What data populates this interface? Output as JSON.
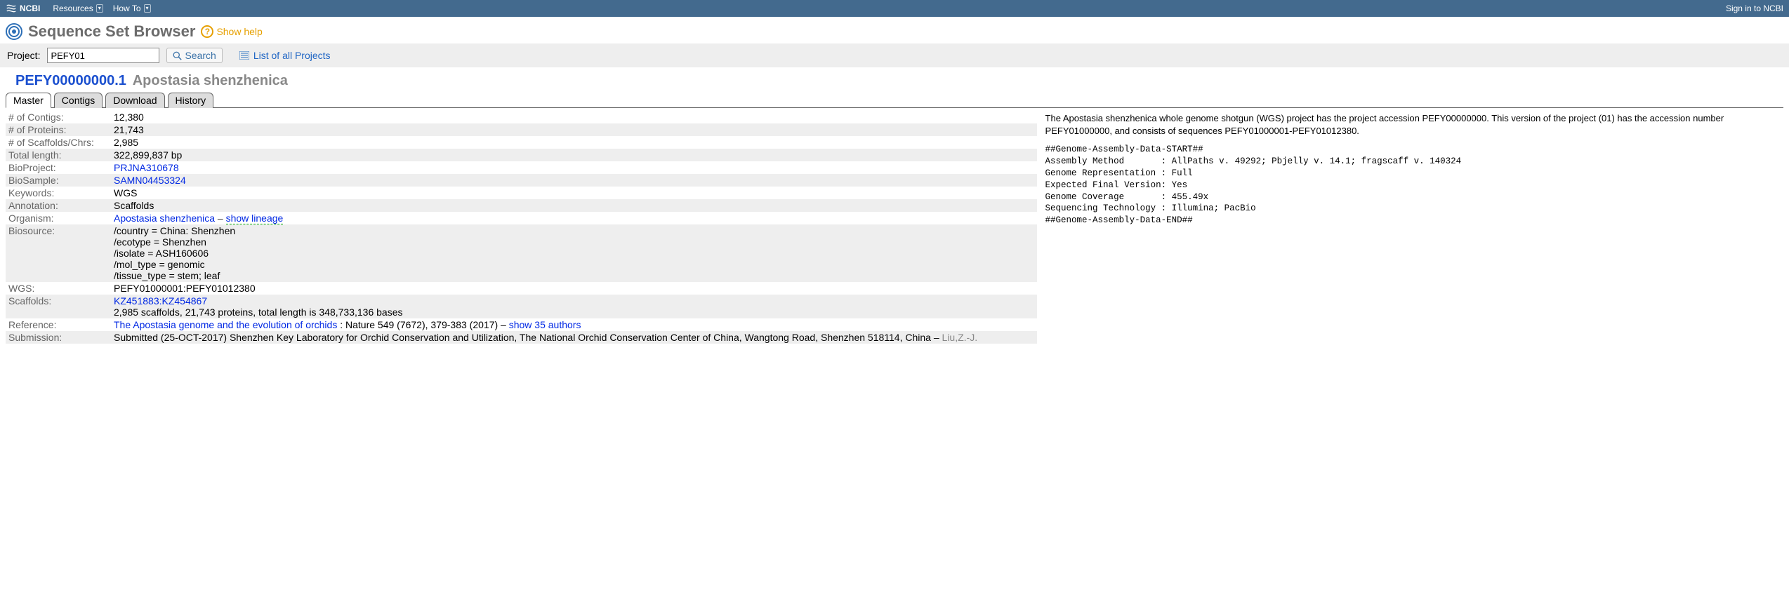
{
  "topnav": {
    "brand": "NCBI",
    "menu1": "Resources",
    "menu2": "How To",
    "signin": "Sign in to NCBI"
  },
  "title": "Sequence Set Browser",
  "help_label": "Show help",
  "search": {
    "label": "Project:",
    "value": "PEFY01",
    "button": "Search",
    "list_link": "List of all Projects"
  },
  "heading": {
    "accession": "PEFY00000000.1",
    "organism": "Apostasia shenzhenica"
  },
  "tabs": [
    "Master",
    "Contigs",
    "Download",
    "History"
  ],
  "meta": {
    "contigs_label": "# of Contigs:",
    "contigs": "12,380",
    "proteins_label": "# of Proteins:",
    "proteins": "21,743",
    "scaff_label": "# of Scaffolds/Chrs:",
    "scaff": "2,985",
    "total_label": "Total length:",
    "total": "322,899,837 bp",
    "bioproject_label": "BioProject:",
    "bioproject": "PRJNA310678",
    "biosample_label": "BioSample:",
    "biosample": "SAMN04453324",
    "keywords_label": "Keywords:",
    "keywords": "WGS",
    "annotation_label": "Annotation:",
    "annotation": "Scaffolds",
    "organism_label": "Organism:",
    "organism_link": "Apostasia shenzhenica",
    "organism_sep": " – ",
    "lineage_link": "show lineage",
    "biosource_label": "Biosource:",
    "bsr1": "/country = China: Shenzhen",
    "bsr2": "/ecotype = Shenzhen",
    "bsr3": "/isolate = ASH160606",
    "bsr4": "/mol_type = genomic",
    "bsr5": "/tissue_type = stem; leaf",
    "wgs_label": "WGS:",
    "wgs": "PEFY01000001:PEFY01012380",
    "scaffolds_label": "Scaffolds:",
    "scaffolds_link": "KZ451883:KZ454867",
    "scaffolds_desc": "2,985 scaffolds, 21,743 proteins, total length is 348,733,136 bases",
    "reference_label": "Reference:",
    "ref_link": "The Apostasia genome and the evolution of orchids",
    "ref_tail": " : Nature 549 (7672), 379-383 (2017) – ",
    "ref_authors_link": "show 35 authors",
    "submission_label": "Submission:",
    "submission_text": "Submitted (25-OCT-2017) Shenzhen Key Laboratory for Orchid Conservation and Utilization, The National Orchid Conservation Center of China, Wangtong Road, Shenzhen 518114, China – ",
    "submission_author": "Liu,Z.-J."
  },
  "description": "The Apostasia shenzhenica whole genome shotgun (WGS) project has the project accession PEFY00000000. This version of the project (01) has the accession number PEFY01000000, and consists of sequences PEFY01000001-PEFY01012380.",
  "assembly_block": "##Genome-Assembly-Data-START##\nAssembly Method       : AllPaths v. 49292; Pbjelly v. 14.1; fragscaff v. 140324\nGenome Representation : Full\nExpected Final Version: Yes\nGenome Coverage       : 455.49x\nSequencing Technology : Illumina; PacBio\n##Genome-Assembly-Data-END##"
}
